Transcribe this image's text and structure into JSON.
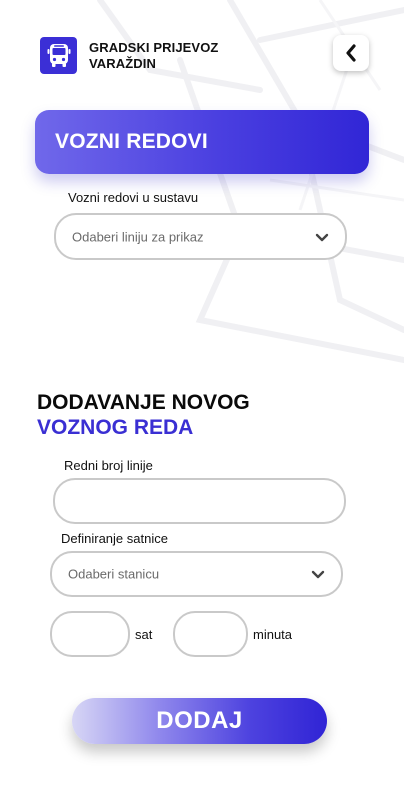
{
  "header": {
    "brand_line1": "GRADSKI PRIJEVOZ",
    "brand_line2": "VARAŽDIN",
    "logo_icon": "bus-icon",
    "back_icon": "chevron-left-icon"
  },
  "schedules": {
    "banner_title": "VOZNI REDOVI",
    "list_label": "Vozni redovi u sustavu",
    "line_select_placeholder": "Odaberi liniju za prikaz"
  },
  "new_schedule": {
    "title_line1": "DODAVANJE NOVOG",
    "title_line2": "VOZNOG REDA",
    "line_number_label": "Redni broj linije",
    "line_number_value": "",
    "timetable_label": "Definiranje satnice",
    "station_select_placeholder": "Odaberi stanicu",
    "hour_value": "",
    "hour_unit": "sat",
    "minute_value": "",
    "minute_unit": "minuta",
    "submit_label": "DODAJ"
  },
  "colors": {
    "accent": "#3b2fd6",
    "accent_text": "#3a2fd3",
    "field_border": "#c9c9c9"
  }
}
